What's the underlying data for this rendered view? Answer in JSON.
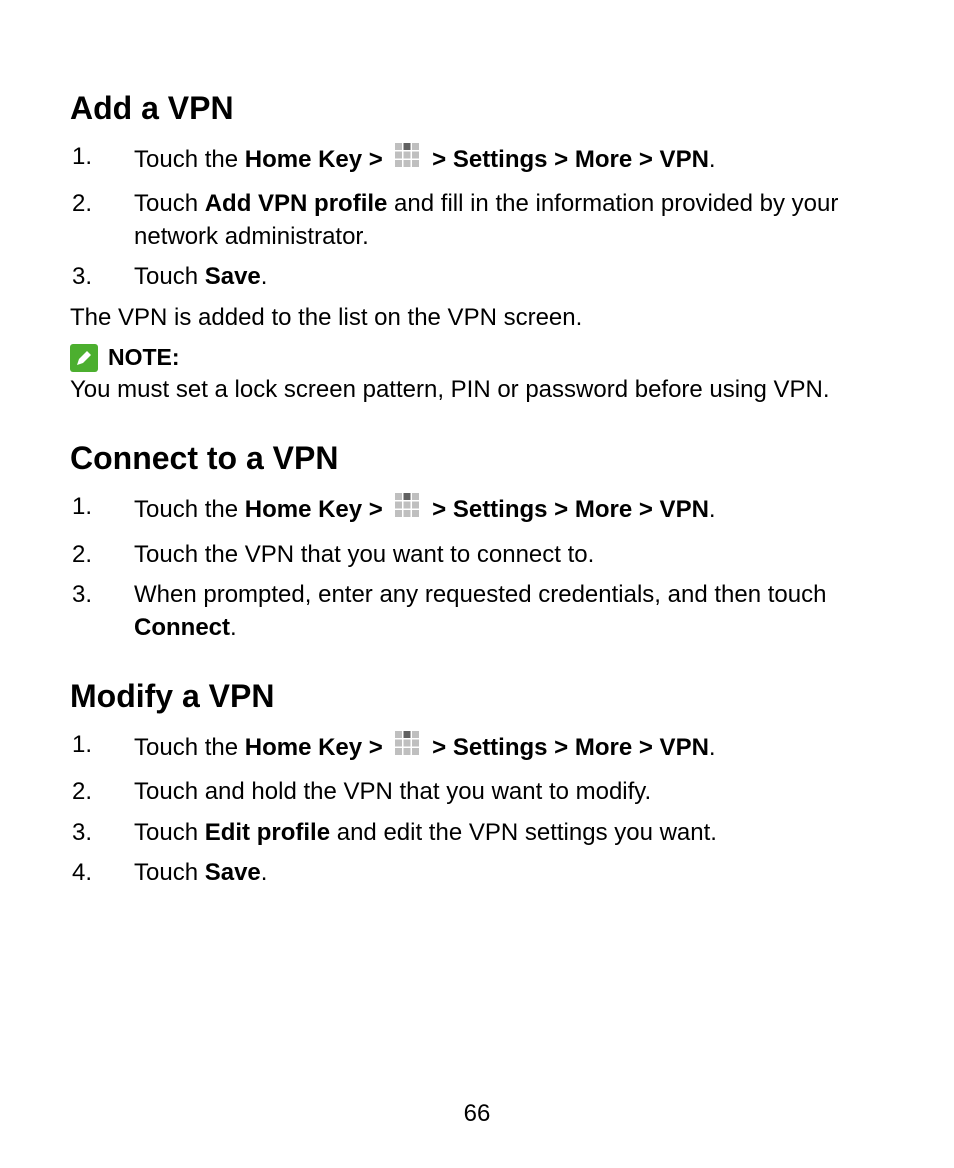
{
  "page_number": "66",
  "sections": {
    "add": {
      "heading": "Add a VPN",
      "step1_pre": "Touch the ",
      "step1_b1": "Home Key > ",
      "step1_b2": " > Settings > More > VPN",
      "step1_post": ".",
      "step2_pre": "Touch ",
      "step2_b": "Add VPN profile",
      "step2_post": " and fill in the information provided by your network administrator.",
      "step3_pre": "Touch ",
      "step3_b": "Save",
      "step3_post": ".",
      "after": "The VPN is added to the list on the VPN screen.",
      "note_label": "NOTE:",
      "note_body": "You must set a lock screen pattern, PIN or password before using VPN."
    },
    "connect": {
      "heading": "Connect to a VPN",
      "step1_pre": "Touch the ",
      "step1_b1": "Home Key > ",
      "step1_b2": " > Settings > More > VPN",
      "step1_post": ".",
      "step2": "Touch the VPN that you want to connect to.",
      "step3_pre": "When prompted, enter any requested credentials, and then touch ",
      "step3_b": "Connect",
      "step3_post": "."
    },
    "modify": {
      "heading": "Modify a VPN",
      "step1_pre": "Touch the ",
      "step1_b1": "Home Key > ",
      "step1_b2": " > Settings > More > VPN",
      "step1_post": ".",
      "step2": "Touch and hold the VPN that you want to modify.",
      "step3_pre": "Touch ",
      "step3_b": "Edit profile",
      "step3_post": " and edit the VPN settings you want.",
      "step4_pre": "Touch ",
      "step4_b": "Save",
      "step4_post": "."
    }
  }
}
